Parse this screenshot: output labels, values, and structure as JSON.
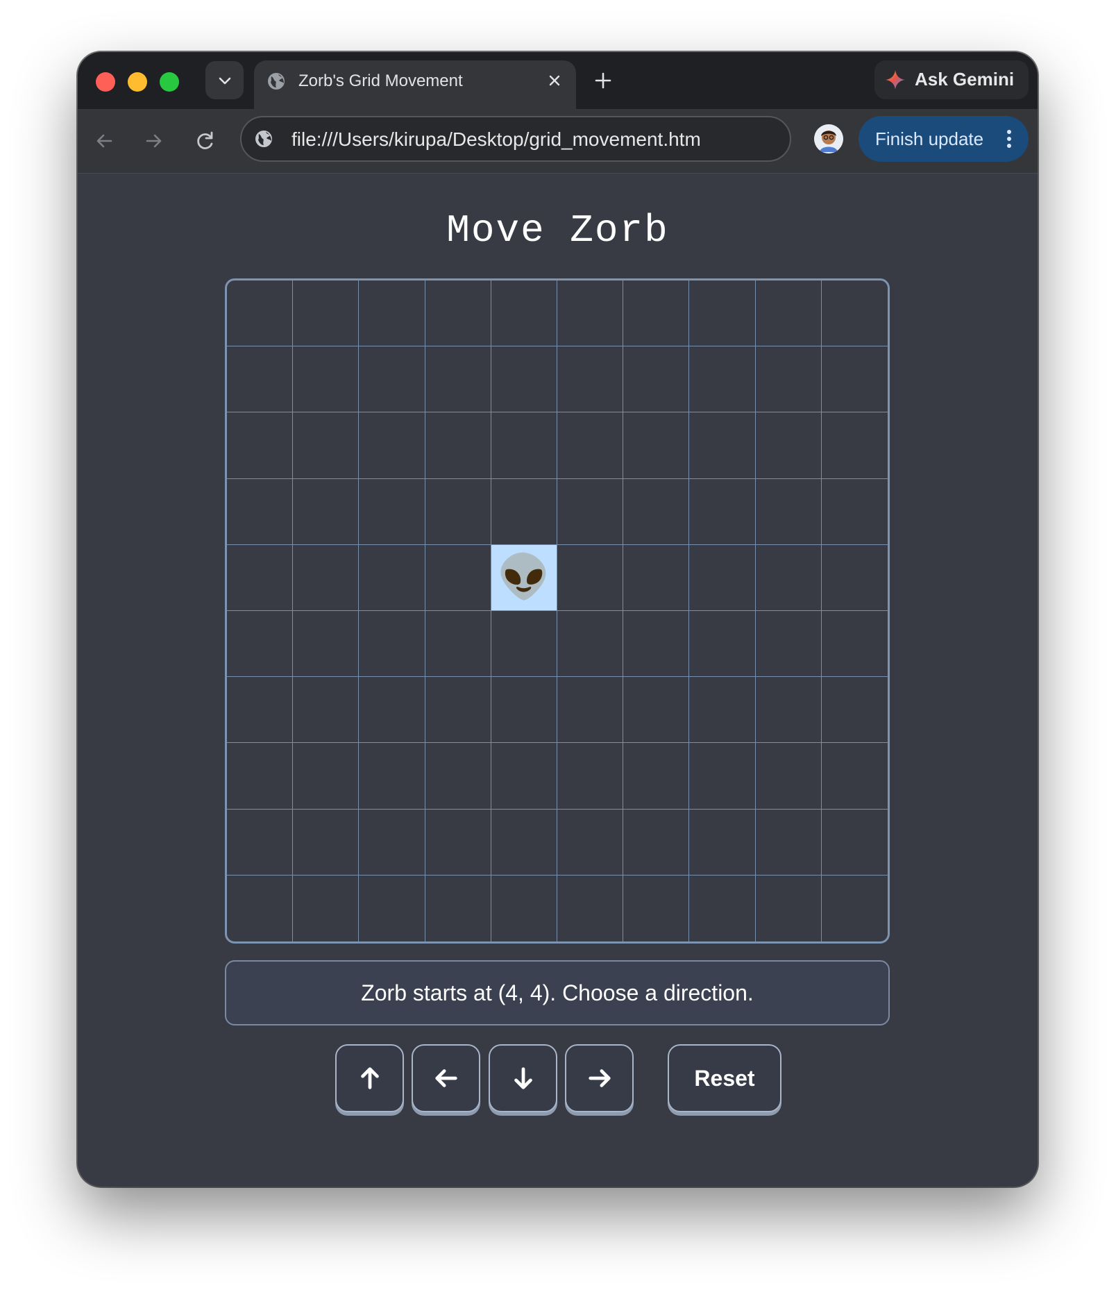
{
  "browser": {
    "tab_title": "Zorb's Grid Movement",
    "ask_gemini_label": "Ask Gemini",
    "url": "file:///Users/kirupa/Desktop/grid_movement.htm",
    "finish_update_label": "Finish update"
  },
  "page": {
    "title": "Move Zorb",
    "grid": {
      "columns": 10,
      "rows": 10,
      "zorb_position": [
        4,
        4
      ],
      "zorb_glyph": "👽"
    },
    "status_text": "Zorb starts at (4, 4). Choose a direction.",
    "controls": {
      "up_icon": "arrow-up-icon",
      "left_icon": "arrow-left-icon",
      "down_icon": "arrow-down-icon",
      "right_icon": "arrow-right-icon",
      "reset_label": "Reset"
    }
  },
  "colors": {
    "page_background": "#393b44",
    "grid_line": "#7890b0",
    "zorb_cell": "#bedeff",
    "finish_update_button": "#1b4b7a"
  }
}
